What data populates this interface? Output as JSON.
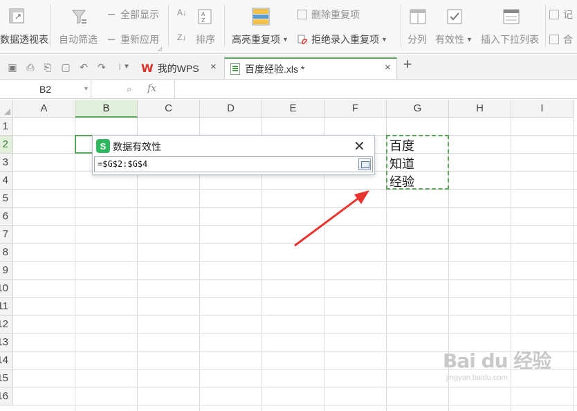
{
  "ribbon": {
    "pivot_label": "数据透视表",
    "autofilter_label": "自动筛选",
    "show_all_label": "全部显示",
    "reapply_label": "重新应用",
    "sort_label": "排序",
    "highlight_dup_label": "高亮重复项",
    "delete_dup_label": "删除重复项",
    "reject_dup_label": "拒绝录入重复项",
    "split_label": "分列",
    "validity_label": "有效性",
    "insert_dropdown_label": "插入下拉列表",
    "record_label": "记",
    "merge_label": "合"
  },
  "tabs": {
    "home_label": "我的WPS",
    "file_label": "百度经验.xls *"
  },
  "formula_bar": {
    "cell_ref": "B2",
    "fx_label": "fx"
  },
  "sheet": {
    "columns": [
      "A",
      "B",
      "C",
      "D",
      "E",
      "F",
      "G",
      "H",
      "I"
    ],
    "rows": [
      "1",
      "2",
      "3",
      "4",
      "5",
      "6",
      "7",
      "8",
      "9",
      "10",
      "11",
      "12",
      "13",
      "14",
      "15",
      "16"
    ],
    "selected_cell": "B2",
    "g_values": [
      "百度",
      "知道",
      "经验"
    ]
  },
  "dialog": {
    "icon_letter": "S",
    "title": "数据有效性",
    "formula": "=$G$2:$G$4"
  },
  "watermark": {
    "brand": "Bai du 经验",
    "url": "jingyan.baidu.com"
  },
  "colors": {
    "accent_green": "#5aa55a",
    "arrow_red": "#e8332f",
    "wps_red": "#e0302a"
  }
}
